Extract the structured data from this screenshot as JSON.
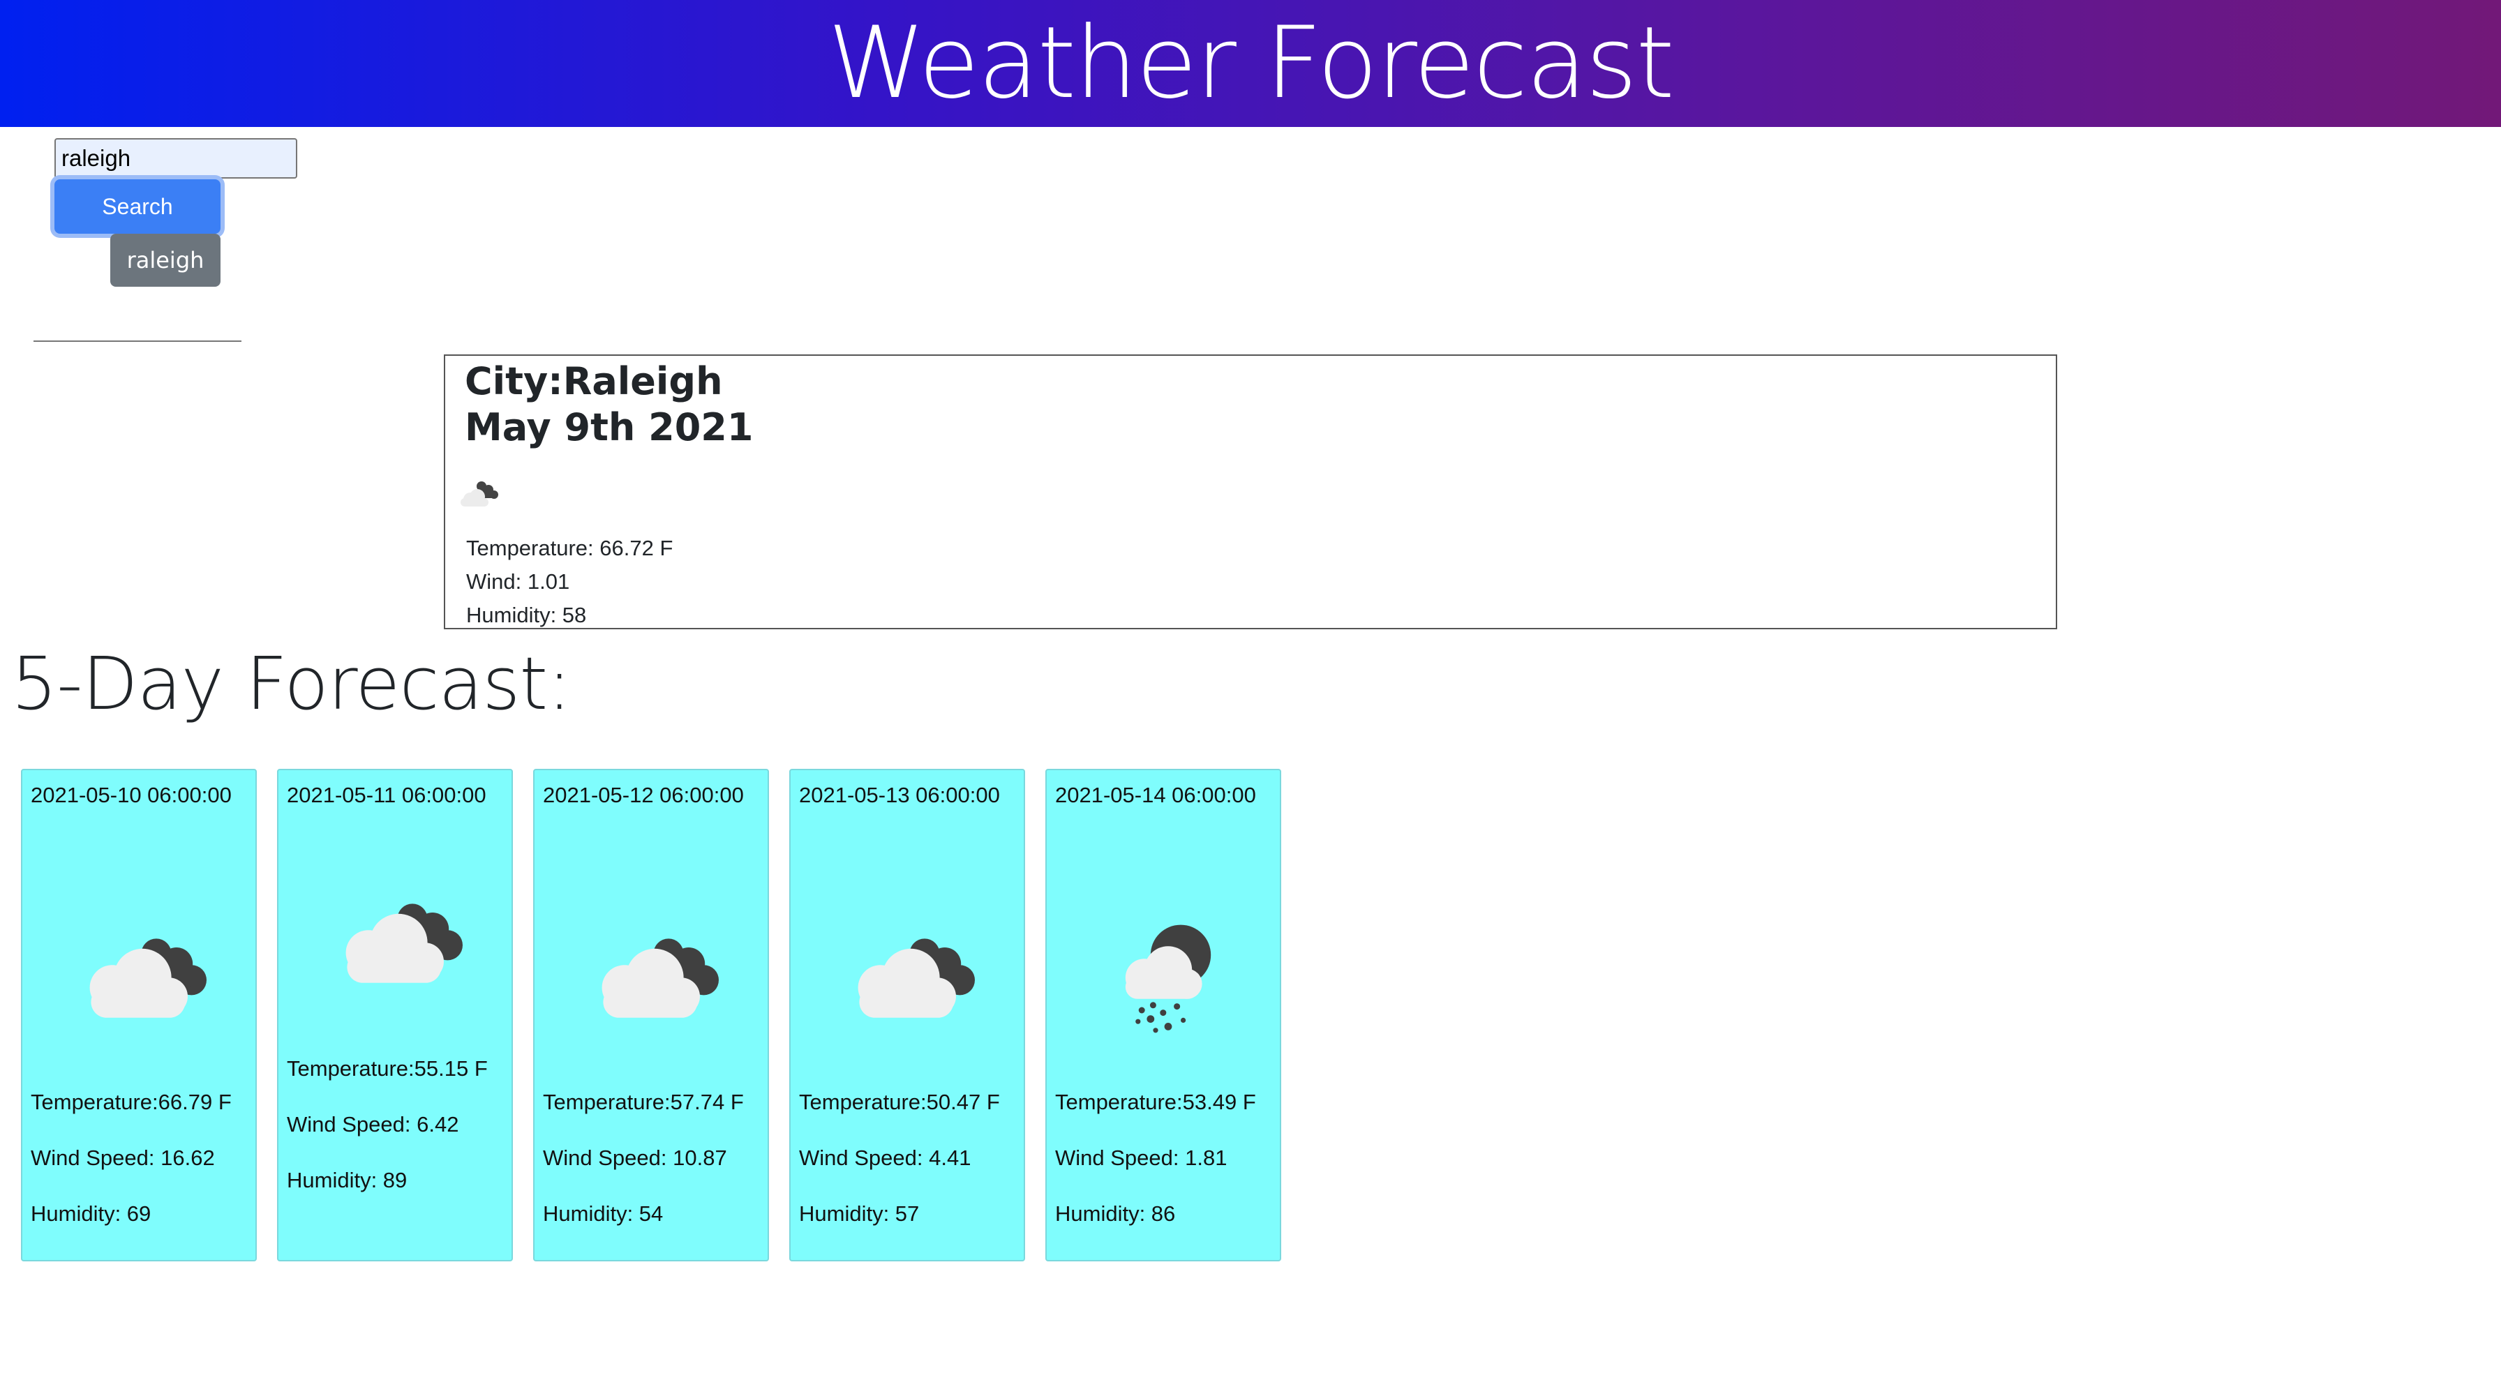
{
  "header": {
    "title": "Weather Forecast"
  },
  "search": {
    "value": "raleigh",
    "button_label": "Search",
    "history": [
      "raleigh"
    ]
  },
  "current": {
    "city_line": "City:Raleigh",
    "date": "May 9th 2021",
    "icon": "clouds-icon",
    "temperature": "Temperature: 66.72 F",
    "wind": "Wind: 1.01",
    "humidity": "Humidity: 58"
  },
  "forecast": {
    "title": "5-Day Forecast:",
    "days": [
      {
        "date": "2021-05-10 06:00:00",
        "icon": "clouds-icon",
        "temp": "Temperature:66.79 F",
        "wind": "Wind Speed: 16.62",
        "humidity": "Humidity: 69"
      },
      {
        "date": "2021-05-11 06:00:00",
        "icon": "clouds-icon",
        "temp": "Temperature:55.15 F",
        "wind": "Wind Speed: 6.42",
        "humidity": "Humidity: 89"
      },
      {
        "date": "2021-05-12 06:00:00",
        "icon": "clouds-icon",
        "temp": "Temperature:57.74 F",
        "wind": "Wind Speed: 10.87",
        "humidity": "Humidity: 54"
      },
      {
        "date": "2021-05-13 06:00:00",
        "icon": "clouds-icon",
        "temp": "Temperature:50.47 F",
        "wind": "Wind Speed: 4.41",
        "humidity": "Humidity: 57"
      },
      {
        "date": "2021-05-14 06:00:00",
        "icon": "rain-icon",
        "temp": "Temperature:53.49 F",
        "wind": "Wind Speed: 1.81",
        "humidity": "Humidity: 86"
      }
    ]
  },
  "colors": {
    "card_bg": "#7ffdfd",
    "search_button": "#3b7ff5",
    "history_button": "#6c757d"
  }
}
